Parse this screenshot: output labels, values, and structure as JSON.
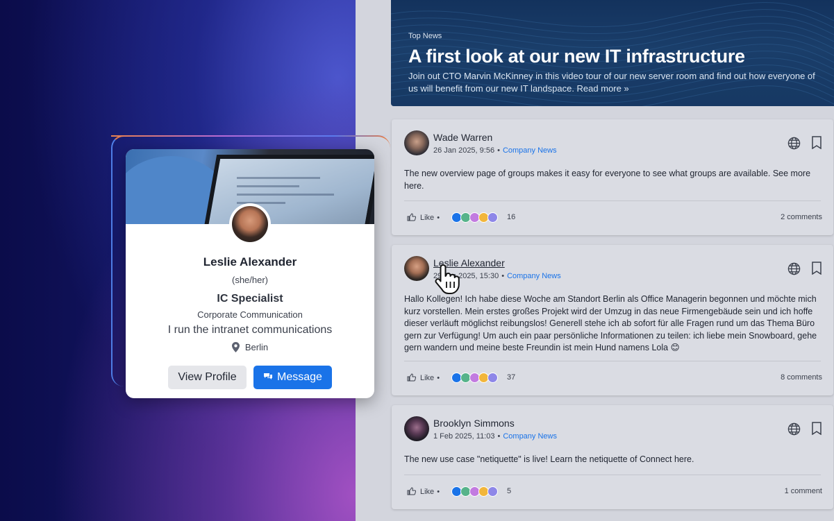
{
  "profile_card": {
    "name": "Leslie Alexander",
    "pronouns": "(she/her)",
    "role": "IC Specialist",
    "department": "Corporate Communication",
    "bio": "I run the intranet communications",
    "location": "Berlin",
    "view_profile_label": "View Profile",
    "message_label": "Message"
  },
  "top_news": {
    "label": "Top News",
    "title": "A first look at our new IT infrastructure",
    "description": "Join out CTO Marvin McKinney in this video tour of our new server room and find out how everyone of us will benefit from our new IT landspace. Read more »"
  },
  "posts": [
    {
      "author": "Wade Warren",
      "date": "26 Jan 2025, 9:56",
      "category": "Company News",
      "text": "The new overview page of groups makes it easy for everyone to see what groups are available. See more here.",
      "like_label": "Like",
      "reaction_count": "16",
      "comments": "2 comments"
    },
    {
      "author": "Leslie Alexander",
      "date": "29 Jan 2025, 15:30",
      "category": "Company News",
      "text": "Hallo Kollegen! Ich habe diese Woche am Standort Berlin als Office Managerin begonnen und möchte mich kurz vorstellen. Mein erstes großes Projekt wird der Umzug in das neue Firmengebäude sein und ich hoffe dieser verläuft möglichst reibungslos! Generell stehe ich ab sofort für alle Fragen rund um das Thema Büro gern zur Verfügung! Um auch ein paar persönliche Informationen zu teilen: ich liebe mein Snowboard, gehe gern wandern und meine beste Freundin ist mein Hund namens Lola 😊",
      "like_label": "Like",
      "reaction_count": "37",
      "comments": "8 comments"
    },
    {
      "author": "Brooklyn Simmons",
      "date": "1 Feb 2025, 11:03",
      "category": "Company News",
      "text": "The new use case \"netiquette\" is live! Learn the netiquette of Connect here.",
      "like_label": "Like",
      "reaction_count": "5",
      "comments": "1 comment"
    }
  ],
  "colors": {
    "accent": "#1a73e8",
    "card_bg": "#dadce3"
  }
}
